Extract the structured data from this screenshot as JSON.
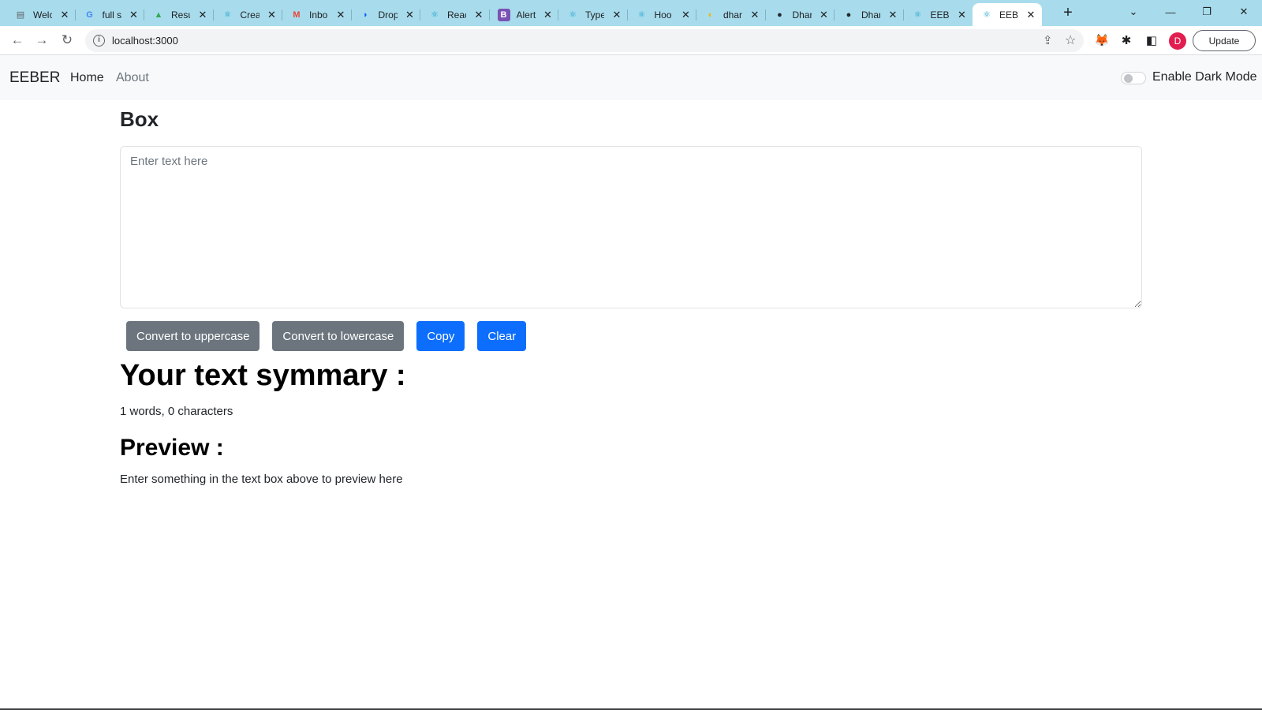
{
  "browser": {
    "tabs": [
      {
        "label": "Welc",
        "icon": "page-icon",
        "icon_color": "#5f6368"
      },
      {
        "label": "full s",
        "icon": "google-icon",
        "icon_color": "#4285f4"
      },
      {
        "label": "Resu",
        "icon": "drive-icon",
        "icon_color": "#34a853"
      },
      {
        "label": "Crea",
        "icon": "react-icon",
        "icon_color": "#149eca"
      },
      {
        "label": "Inbo",
        "icon": "gmail-icon",
        "icon_color": "#ea4335"
      },
      {
        "label": "Drop",
        "icon": "dropbox-icon",
        "icon_color": "#0061fe"
      },
      {
        "label": "Reac",
        "icon": "react-icon",
        "icon_color": "#149eca"
      },
      {
        "label": "Alert",
        "icon": "bootstrap-icon",
        "icon_color": "#7952b3"
      },
      {
        "label": "Type",
        "icon": "react-icon",
        "icon_color": "#149eca"
      },
      {
        "label": "Hoo",
        "icon": "react-icon",
        "icon_color": "#149eca"
      },
      {
        "label": "dhar",
        "icon": "netlify-icon",
        "icon_color": "#f4b400"
      },
      {
        "label": "Dhar",
        "icon": "github-icon",
        "icon_color": "#24292f"
      },
      {
        "label": "Dhar",
        "icon": "github-icon",
        "icon_color": "#24292f"
      },
      {
        "label": "EEBE",
        "icon": "react-icon",
        "icon_color": "#149eca"
      },
      {
        "label": "EEBE",
        "icon": "react-icon",
        "icon_color": "#149eca",
        "active": true
      }
    ],
    "url": "localhost:3000",
    "update_label": "Update",
    "avatar_letter": "D"
  },
  "app": {
    "brand": "EEBER",
    "nav": {
      "home": "Home",
      "about": "About"
    },
    "dark_mode_label": "Enable Dark Mode",
    "dark_mode_on": false,
    "box_title": "Box",
    "textarea_placeholder": "Enter text here",
    "textarea_value": "",
    "buttons": {
      "uppercase": "Convert to uppercase",
      "lowercase": "Convert to lowercase",
      "copy": "Copy",
      "clear": "Clear"
    },
    "summary_title": "Your text symmary :",
    "summary_text": "1 words, 0 characters",
    "preview_title": "Preview :",
    "preview_text": "Enter something in the text box above to preview here"
  }
}
